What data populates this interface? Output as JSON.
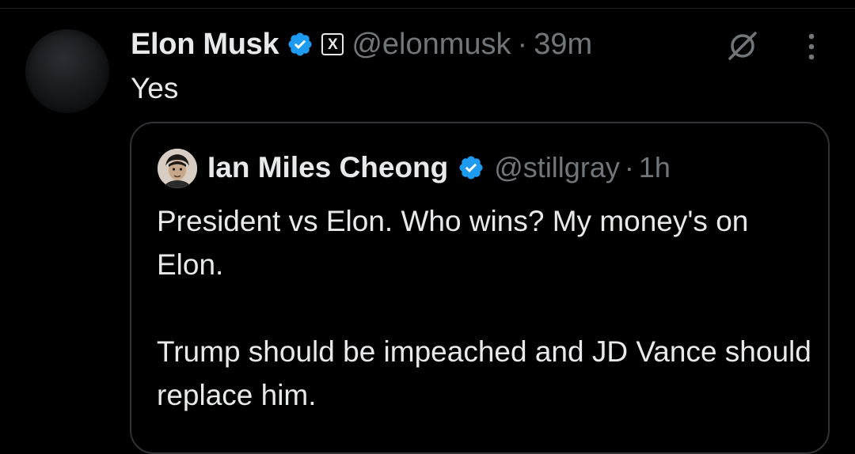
{
  "post": {
    "author_name": "Elon Musk",
    "handle": "@elonmusk",
    "separator": "·",
    "time": "39m",
    "affiliation_badge": "X",
    "text": "Yes",
    "icons": {
      "verified": "verified-badge-icon",
      "grok": "grok-icon",
      "more": "more-options-icon"
    },
    "colors": {
      "verified_blue": "#1d9bf0",
      "muted_text": "#71767b",
      "primary_text": "#e7e9ea",
      "background": "#000000",
      "border": "#2f3336"
    }
  },
  "quoted_post": {
    "author_name": "Ian Miles Cheong",
    "handle": "@stillgray",
    "separator": "·",
    "time": "1h",
    "paragraphs": [
      "President vs Elon. Who wins? My money's on Elon.",
      "Trump should be impeached and JD Vance should replace him."
    ]
  }
}
